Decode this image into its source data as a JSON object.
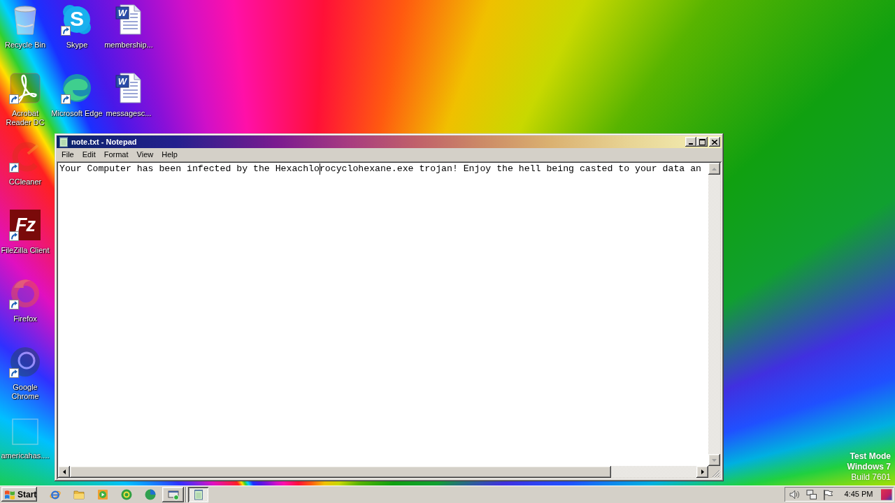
{
  "desktop": {
    "icon_columns": [
      {
        "icons": [
          {
            "label": "Recycle Bin",
            "shortcut": false,
            "dimmed": false
          },
          {
            "label": "Acrobat Reader DC",
            "shortcut": true,
            "dimmed": false
          },
          {
            "label": "CCleaner",
            "shortcut": true,
            "dimmed": true
          },
          {
            "label": "FileZilla Client",
            "glyph": "Fz",
            "shortcut": true,
            "dimmed": false
          },
          {
            "label": "Firefox",
            "shortcut": true,
            "dimmed": true
          },
          {
            "label": "Google Chrome",
            "shortcut": true,
            "dimmed": true
          },
          {
            "label": "americahas....",
            "shortcut": false,
            "dimmed": true
          }
        ]
      },
      {
        "icons": [
          {
            "label": "Skype",
            "glyph": "S",
            "shortcut": true,
            "dimmed": false
          },
          {
            "label": "Microsoft Edge",
            "shortcut": true,
            "dimmed": false
          }
        ]
      },
      {
        "icons": [
          {
            "label": "membership...",
            "glyph": "W",
            "shortcut": false,
            "dimmed": false
          },
          {
            "label": "messagesc...",
            "glyph": "W",
            "shortcut": false,
            "dimmed": false
          }
        ]
      }
    ],
    "test_mode_lines": [
      {
        "text": "Test Mode",
        "bold": true
      },
      {
        "text": "Windows 7",
        "bold": true
      },
      {
        "text": "Build 7601",
        "bold": false
      }
    ]
  },
  "notepad": {
    "title": "note.txt - Notepad",
    "menu": [
      "File",
      "Edit",
      "Format",
      "View",
      "Help"
    ],
    "text_before_cursor": "Your Computer has been infected by the Hexachlo",
    "text_after_cursor": "rocyclohexane.exe trojan! Enjoy the hell being casted to your data an"
  },
  "taskbar": {
    "start_label": "Start",
    "task_buttons": [
      {
        "selected": false
      },
      {
        "selected": true
      }
    ],
    "clock": "4:45 PM"
  }
}
